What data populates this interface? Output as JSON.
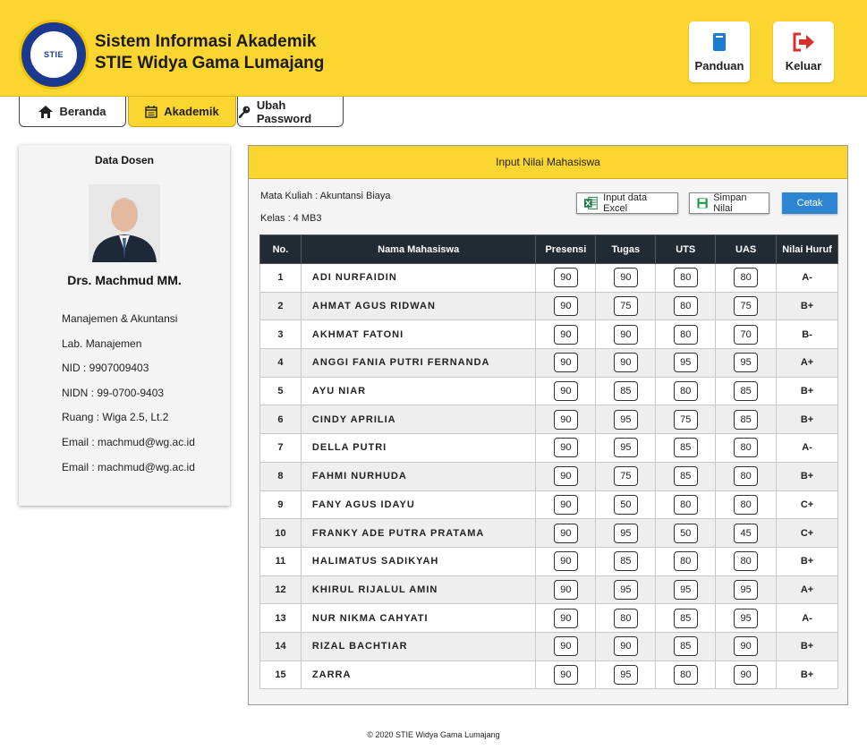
{
  "header": {
    "logo_text": "STIE",
    "title_line1": "Sistem Informasi Akademik",
    "title_line2": "STIE Widya Gama Lumajang",
    "panduan_label": "Panduan",
    "keluar_label": "Keluar",
    "bg_color": "#fbd530"
  },
  "tabs": [
    {
      "label": "Beranda",
      "icon": "home-icon"
    },
    {
      "label": "Akademik",
      "icon": "calendar-icon",
      "active": true
    },
    {
      "label": "Ubah Password",
      "icon": "key-icon"
    }
  ],
  "sidebar": {
    "title": "Data Dosen",
    "name": "Drs. Machmud MM.",
    "info": [
      "Manajemen & Akuntansi",
      "Lab. Manajemen",
      "NID : 9907009403",
      "NIDN : 99-0700-9403",
      "Ruang : Wiga 2.5, Lt.2",
      "Email : machmud@wg.ac.id",
      "Email : machmud@wg.ac.id"
    ]
  },
  "panel": {
    "title": "Input Nilai Mahasiswa",
    "mata_kuliah": "Mata Kuliah : Akuntansi Biaya",
    "kelas": "Kelas : 4 MB3",
    "btn_excel": "Input data Excel",
    "btn_simpan": "Simpan Nilai",
    "btn_cetak": "Cetak"
  },
  "table": {
    "headers": [
      "No.",
      "Nama Mahasiswa",
      "Presensi",
      "Tugas",
      "UTS",
      "UAS",
      "Nilai Huruf"
    ],
    "rows": [
      [
        "1",
        "ADI NURFAIDIN",
        "90",
        "90",
        "80",
        "80",
        "A-"
      ],
      [
        "2",
        "AHMAT AGUS RIDWAN",
        "90",
        "75",
        "80",
        "75",
        "B+"
      ],
      [
        "3",
        "AKHMAT FATONI",
        "90",
        "90",
        "80",
        "70",
        "B-"
      ],
      [
        "4",
        "ANGGI FANIA PUTRI FERNANDA",
        "90",
        "90",
        "95",
        "95",
        "A+"
      ],
      [
        "5",
        "AYU NIAR",
        "90",
        "85",
        "80",
        "85",
        "B+"
      ],
      [
        "6",
        "CINDY APRILIA",
        "90",
        "95",
        "75",
        "85",
        "B+"
      ],
      [
        "7",
        "DELLA PUTRI",
        "90",
        "95",
        "85",
        "80",
        "A-"
      ],
      [
        "8",
        "FAHMI NURHUDA",
        "90",
        "75",
        "85",
        "80",
        "B+"
      ],
      [
        "9",
        "FANY AGUS IDAYU",
        "90",
        "50",
        "80",
        "80",
        "C+"
      ],
      [
        "10",
        "FRANKY ADE PUTRA PRATAMA",
        "90",
        "95",
        "50",
        "45",
        "C+"
      ],
      [
        "11",
        "HALIMATUS SADIKYAH",
        "90",
        "85",
        "80",
        "80",
        "B+"
      ],
      [
        "12",
        "KHIRUL RIJALUL AMIN",
        "90",
        "95",
        "95",
        "95",
        "A+"
      ],
      [
        "13",
        "NUR NIKMA CAHYATI",
        "90",
        "80",
        "85",
        "95",
        "A-"
      ],
      [
        "14",
        "RIZAL BACHTIAR",
        "90",
        "90",
        "85",
        "90",
        "B+"
      ],
      [
        "15",
        "ZARRA",
        "90",
        "95",
        "80",
        "90",
        "B+"
      ]
    ]
  },
  "footer": {
    "text": "© 2020 STIE Widya Gama Lumajang"
  }
}
